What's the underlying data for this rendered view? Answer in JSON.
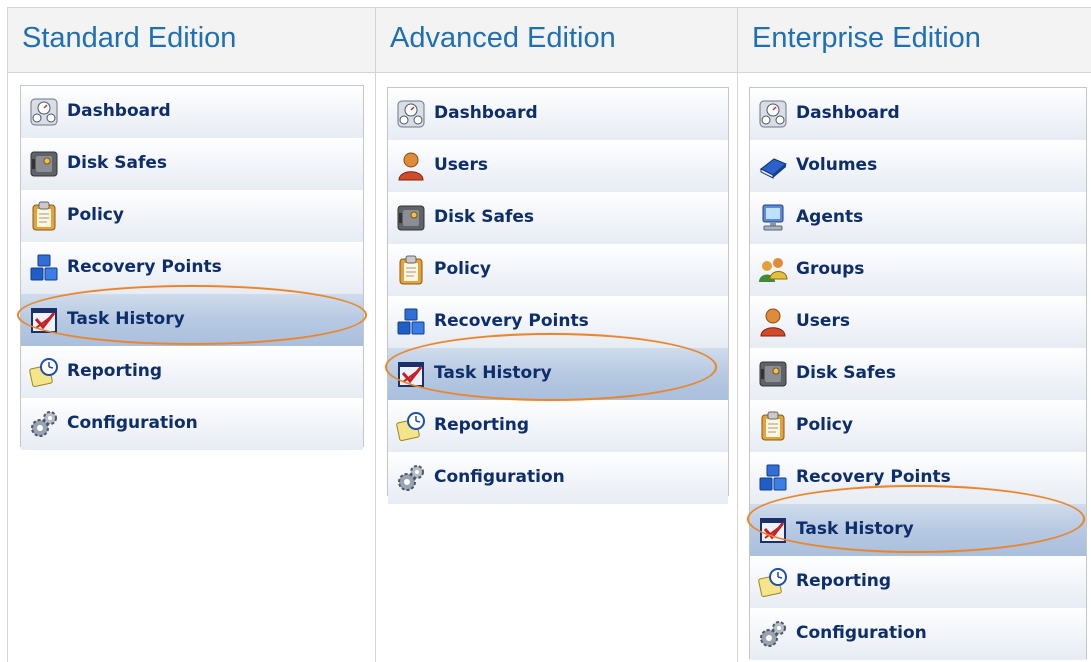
{
  "columns": [
    {
      "title": "Standard Edition",
      "items": [
        {
          "label": "Dashboard",
          "icon": "dashboard-icon"
        },
        {
          "label": "Disk Safes",
          "icon": "safe-icon"
        },
        {
          "label": "Policy",
          "icon": "clipboard-icon"
        },
        {
          "label": "Recovery Points",
          "icon": "cubes-icon"
        },
        {
          "label": "Task History",
          "icon": "task-checkbox-icon",
          "selected": true
        },
        {
          "label": "Reporting",
          "icon": "report-clock-icon"
        },
        {
          "label": "Configuration",
          "icon": "gears-icon"
        }
      ]
    },
    {
      "title": "Advanced Edition",
      "items": [
        {
          "label": "Dashboard",
          "icon": "dashboard-icon"
        },
        {
          "label": "Users",
          "icon": "user-icon"
        },
        {
          "label": "Disk Safes",
          "icon": "safe-icon"
        },
        {
          "label": "Policy",
          "icon": "clipboard-icon"
        },
        {
          "label": "Recovery Points",
          "icon": "cubes-icon"
        },
        {
          "label": "Task History",
          "icon": "task-checkbox-icon",
          "selected": true
        },
        {
          "label": "Reporting",
          "icon": "report-clock-icon"
        },
        {
          "label": "Configuration",
          "icon": "gears-icon"
        }
      ]
    },
    {
      "title": "Enterprise Edition",
      "items": [
        {
          "label": "Dashboard",
          "icon": "dashboard-icon"
        },
        {
          "label": "Volumes",
          "icon": "book-icon"
        },
        {
          "label": "Agents",
          "icon": "monitor-icon"
        },
        {
          "label": "Groups",
          "icon": "group-icon"
        },
        {
          "label": "Users",
          "icon": "user-icon"
        },
        {
          "label": "Disk Safes",
          "icon": "safe-icon"
        },
        {
          "label": "Policy",
          "icon": "clipboard-icon"
        },
        {
          "label": "Recovery Points",
          "icon": "cubes-icon"
        },
        {
          "label": "Task History",
          "icon": "task-checkbox-icon",
          "selected": true
        },
        {
          "label": "Reporting",
          "icon": "report-clock-icon"
        },
        {
          "label": "Configuration",
          "icon": "gears-icon"
        }
      ]
    }
  ],
  "colors": {
    "header_text": "#1f6fb4",
    "menu_text": "#0d2d6b",
    "highlight_ring": "#e8862e",
    "selected_row": "#b7c9e2"
  }
}
